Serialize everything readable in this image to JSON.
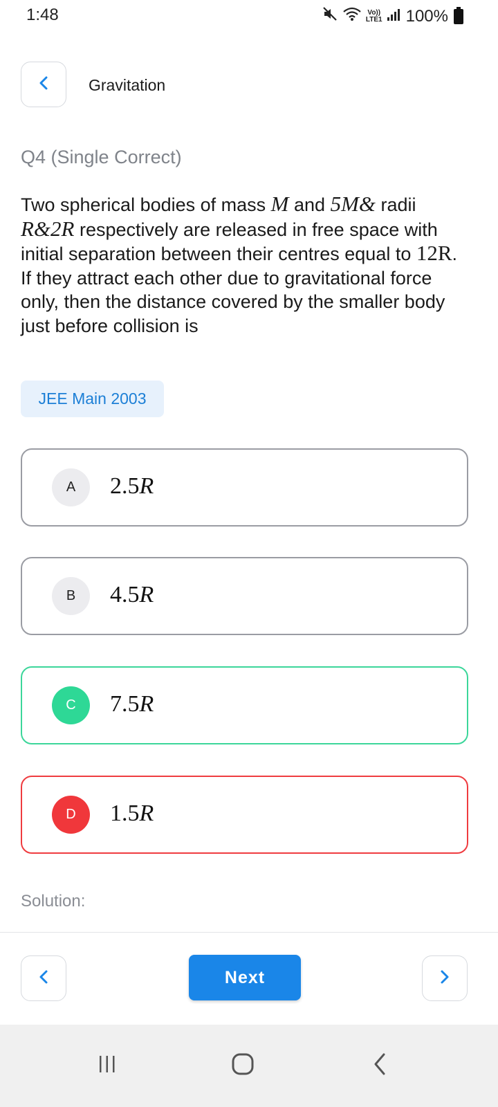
{
  "status_bar": {
    "time": "1:48",
    "battery_text": "100%",
    "network_label_top": "Vo))",
    "network_label_bottom": "LTE1"
  },
  "header": {
    "title": "Gravitation"
  },
  "question": {
    "type_label": "Q4 (Single Correct)",
    "text_parts": {
      "p1": "Two spherical bodies of mass ",
      "m1": "M",
      "p2": " and ",
      "m2": "5M&",
      "p3": " radii ",
      "m3": "R&2R",
      "p4": " respectively are released in free space with initial separation between their centres equal to ",
      "m4": "12R",
      "p5": ". If they attract each other due to gravitational force only, then the distance covered by the smaller body just before collision is"
    },
    "tag": "JEE Main 2003"
  },
  "options": [
    {
      "letter": "A",
      "num": "2.5",
      "unit": "R",
      "state": "neutral"
    },
    {
      "letter": "B",
      "num": "4.5",
      "unit": "R",
      "state": "neutral"
    },
    {
      "letter": "C",
      "num": "7.5",
      "unit": "R",
      "state": "correct"
    },
    {
      "letter": "D",
      "num": "1.5",
      "unit": "R",
      "state": "wrong"
    }
  ],
  "solution": {
    "label": "Solution:"
  },
  "footer": {
    "next_label": "Next"
  },
  "colors": {
    "accent": "#1a86e8",
    "correct": "#2ed896",
    "wrong": "#f0373b",
    "tag_bg": "#e7f1fc"
  }
}
